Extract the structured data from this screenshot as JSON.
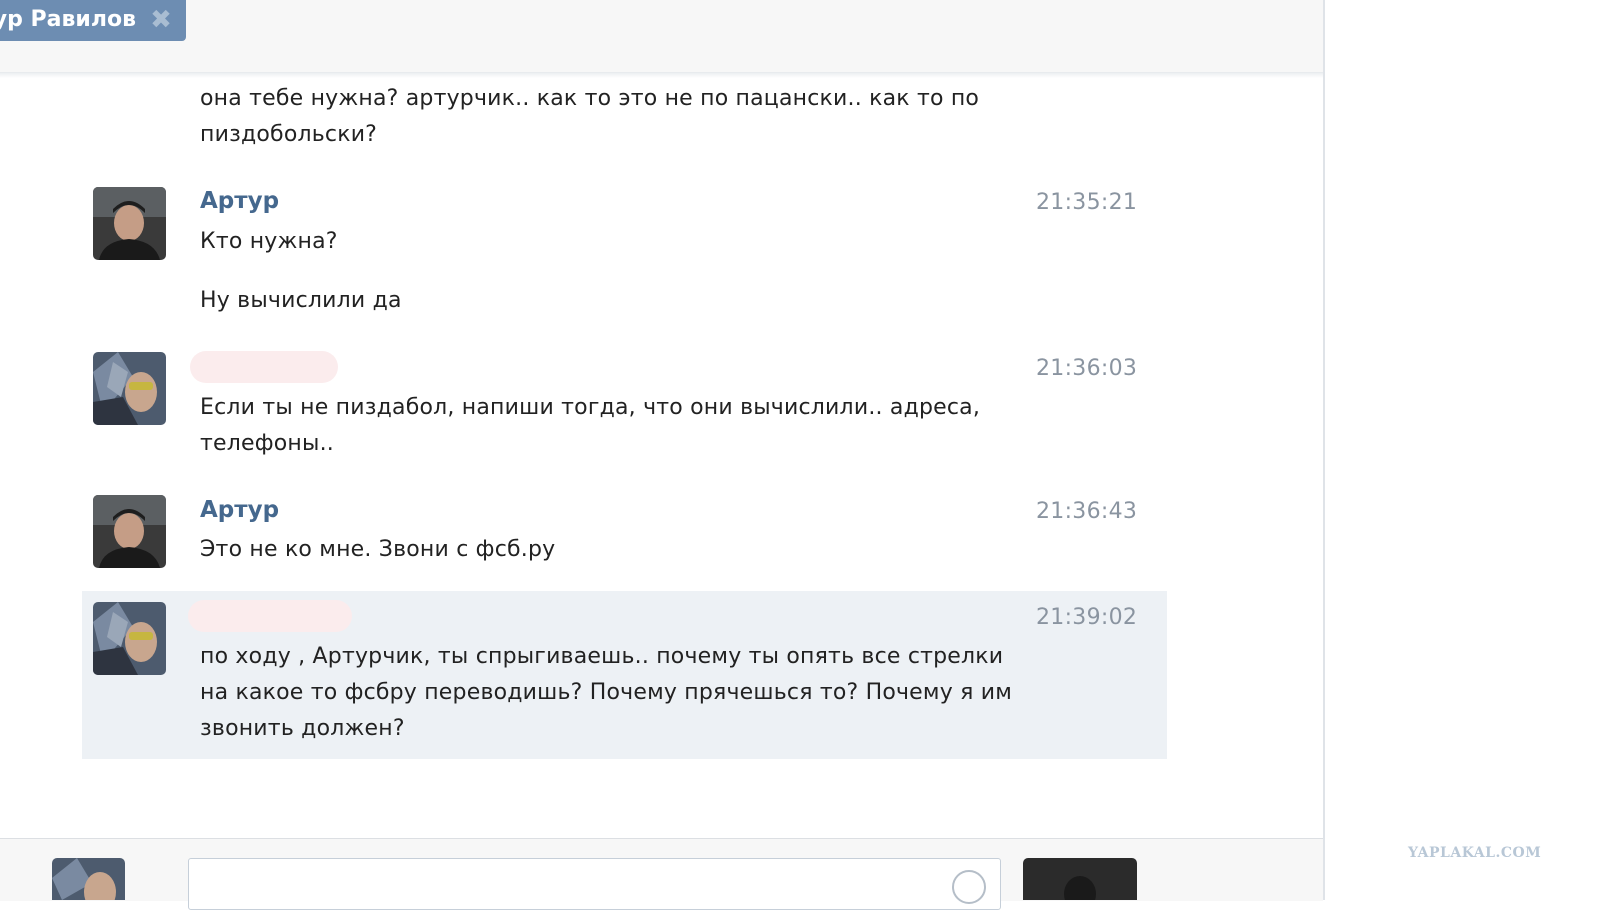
{
  "tab": {
    "title": "ур Равилов",
    "close_icon": "close-icon"
  },
  "messages": [
    {
      "id": "m0",
      "author": "",
      "time": "",
      "lines": [
        "она тебе нужна? артурчик.. как то это не по пацански.. как то по",
        "пиздобольски?"
      ]
    },
    {
      "id": "m1",
      "author": "Артур",
      "time": "21:35:21",
      "lines": [
        "Кто нужна?"
      ],
      "extra": "Ну вычислили да"
    },
    {
      "id": "m2",
      "author": "",
      "time": "21:36:03",
      "lines": [
        "Если ты не пиздабол, напиши тогда, что они вычислили.. адреса,",
        "телефоны.."
      ]
    },
    {
      "id": "m3",
      "author": "Артур",
      "time": "21:36:43",
      "lines": [
        "Это не ко мне. Звони с фсб.ру"
      ]
    },
    {
      "id": "m4",
      "author": "",
      "time": "21:39:02",
      "lines": [
        "по ходу , Артурчик, ты спрыгиваешь.. почему ты опять все стрелки",
        "на какое то фсбру переводишь? Почему прячешься то? Почему я им",
        "звонить должен?"
      ]
    }
  ],
  "composer": {
    "placeholder": "",
    "emoji_icon": "smile-icon"
  },
  "watermark": "YAPLAKAL.COM",
  "colors": {
    "link": "#45688e",
    "tab": "#6d8db2",
    "highlight": "#edf1f5",
    "time": "#8a94a0"
  }
}
